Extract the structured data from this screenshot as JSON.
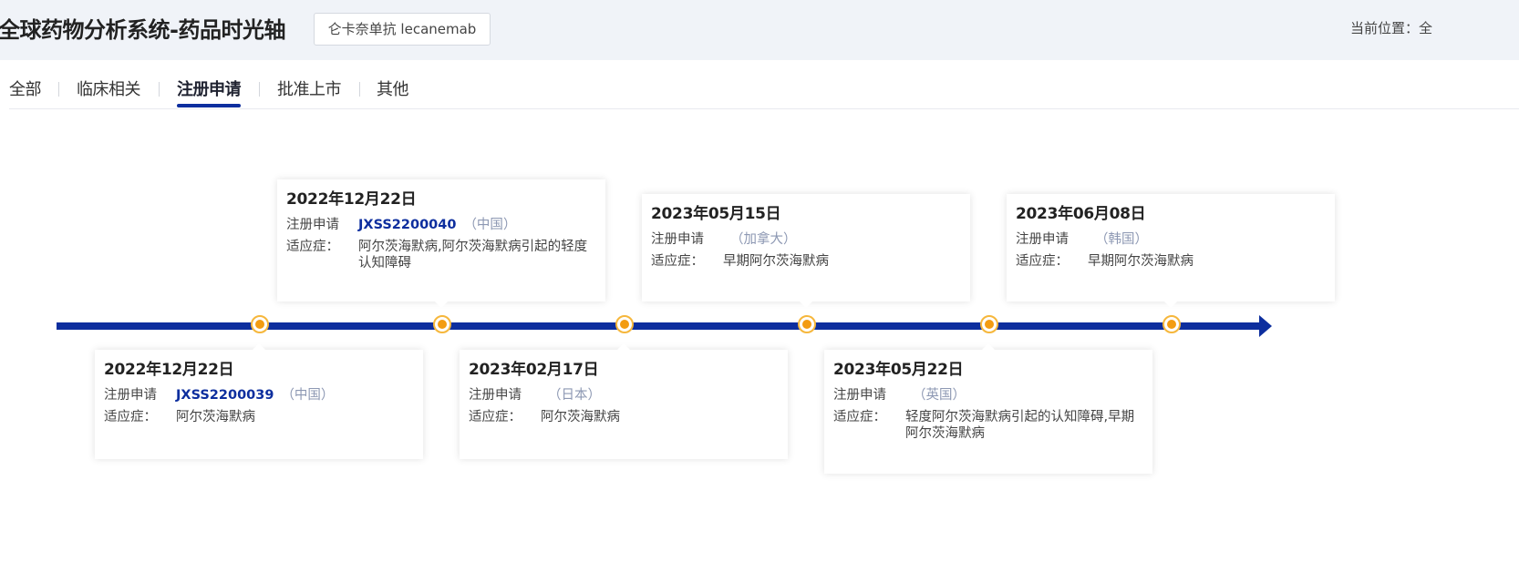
{
  "header": {
    "title": "全球药物分析系统-药品时光轴",
    "drug_tag": "仑卡奈单抗 lecanemab",
    "location": "当前位置：全"
  },
  "tabs": [
    {
      "label": "全部",
      "active": false
    },
    {
      "label": "临床相关",
      "active": false
    },
    {
      "label": "注册申请",
      "active": true
    },
    {
      "label": "批准上市",
      "active": false
    },
    {
      "label": "其他",
      "active": false
    }
  ],
  "labels": {
    "type": "注册申请",
    "indication": "适应症："
  },
  "events": [
    {
      "date": "2022年12月22日",
      "code": "JXSS2200039",
      "region": "（中国）",
      "indication": "阿尔茨海默病"
    },
    {
      "date": "2022年12月22日",
      "code": "JXSS2200040",
      "region": "（中国）",
      "indication": "阿尔茨海默病,阿尔茨海默病引起的轻度认知障碍"
    },
    {
      "date": "2023年02月17日",
      "code": "",
      "region": "（日本）",
      "indication": "阿尔茨海默病"
    },
    {
      "date": "2023年05月15日",
      "code": "",
      "region": "（加拿大）",
      "indication": "早期阿尔茨海默病"
    },
    {
      "date": "2023年05月22日",
      "code": "",
      "region": "（英国）",
      "indication": "轻度阿尔茨海默病引起的认知障碍,早期阿尔茨海默病"
    },
    {
      "date": "2023年06月08日",
      "code": "",
      "region": "（韩国）",
      "indication": "早期阿尔茨海默病"
    }
  ],
  "colors": {
    "axis": "#0d2e9e",
    "node": "#f39c12",
    "code": "#0d2e9e",
    "region": "#8d98b3",
    "header_bg": "#f0f3f8"
  }
}
